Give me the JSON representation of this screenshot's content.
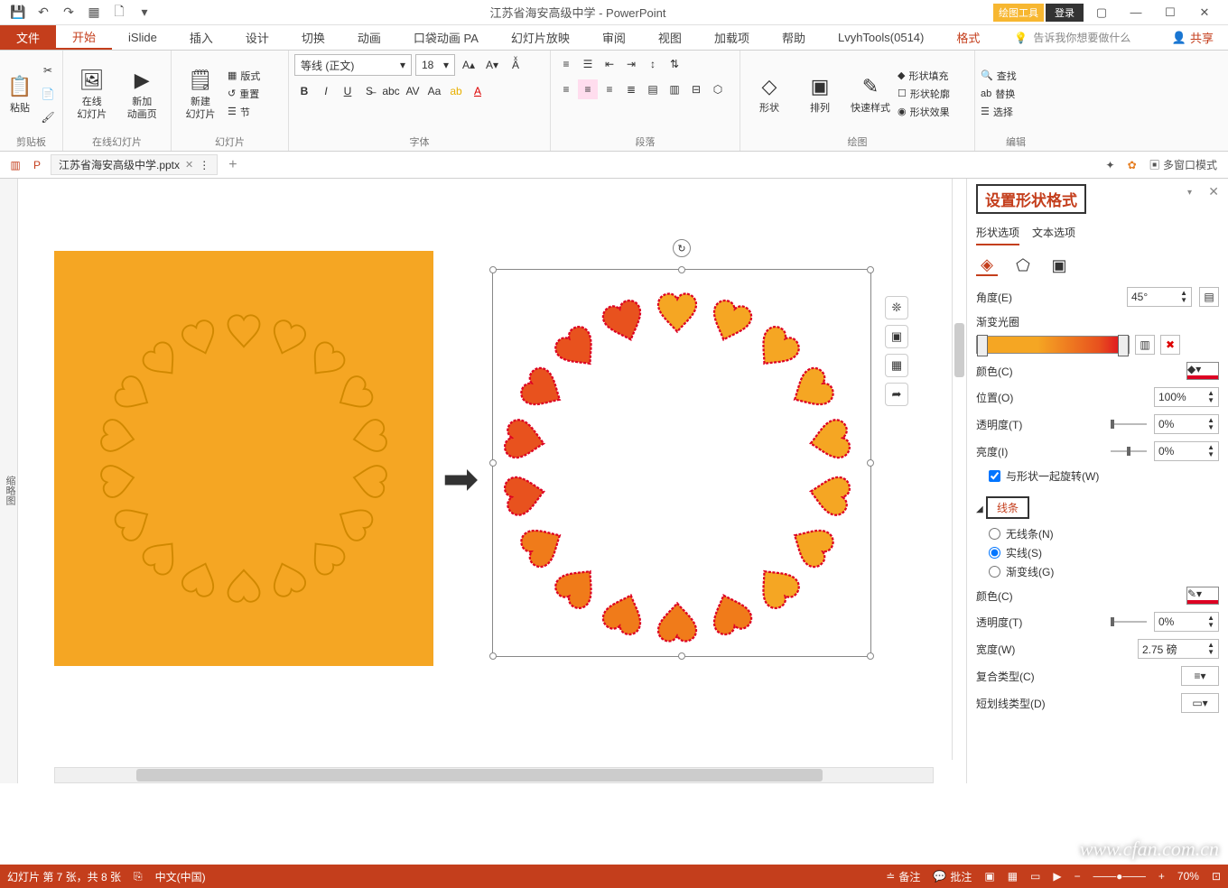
{
  "titlebar": {
    "doc_title": "江苏省海安高级中学 - PowerPoint",
    "contextual": "绘图工具",
    "login": "登录"
  },
  "ribbon_tabs": {
    "file": "文件",
    "home": "开始",
    "islide": "iSlide",
    "insert": "插入",
    "design": "设计",
    "transition": "切换",
    "animation": "动画",
    "pa": "口袋动画 PA",
    "slideshow": "幻灯片放映",
    "review": "审阅",
    "view": "视图",
    "addin": "加载项",
    "help": "帮助",
    "lvyh": "LvyhTools(0514)",
    "format": "格式",
    "tellme": "告诉我你想要做什么",
    "share": "共享"
  },
  "ribbon": {
    "clipboard": {
      "paste": "粘贴",
      "label": "剪贴板"
    },
    "online": {
      "online_anim": "在线\n幻灯片",
      "add_anim": "新加\n动画页",
      "label": "在线幻灯片"
    },
    "slides": {
      "new_slide": "新建\n幻灯片",
      "layout": "版式",
      "reset": "重置",
      "section": "节",
      "label": "幻灯片"
    },
    "font": {
      "name": "等线 (正文)",
      "size": "18",
      "label": "字体"
    },
    "paragraph": {
      "label": "段落"
    },
    "drawing": {
      "shapes": "形状",
      "arrange": "排列",
      "quickstyle": "快速样式",
      "fill": "形状填充",
      "outline": "形状轮廓",
      "effects": "形状效果",
      "label": "绘图"
    },
    "editing": {
      "find": "查找",
      "replace": "替换",
      "select": "选择",
      "label": "编辑"
    }
  },
  "doc_tabs": {
    "tab1": "江苏省海安高级中学.pptx",
    "multi_window": "多窗口模式"
  },
  "collapse_label": "缩略图",
  "format_pane": {
    "title": "设置形状格式",
    "shape_opts": "形状选项",
    "text_opts": "文本选项",
    "angle_label": "角度(E)",
    "angle_val": "45°",
    "gradient_stops": "渐变光圈",
    "color_label": "颜色(C)",
    "position_label": "位置(O)",
    "position_val": "100%",
    "transparency_label": "透明度(T)",
    "transparency_val": "0%",
    "brightness_label": "亮度(I)",
    "brightness_val": "0%",
    "rotate_with": "与形状一起旋转(W)",
    "line_section": "线条",
    "no_line": "无线条(N)",
    "solid_line": "实线(S)",
    "gradient_line": "渐变线(G)",
    "line_color_label": "颜色(C)",
    "line_trans_label": "透明度(T)",
    "line_trans_val": "0%",
    "width_label": "宽度(W)",
    "width_val": "2.75 磅",
    "compound_label": "复合类型(C)",
    "dash_label": "短划线类型(D)"
  },
  "statusbar": {
    "slide_info": "幻灯片 第 7 张，共 8 张",
    "lang": "中文(中国)",
    "notes": "备注",
    "comments": "批注",
    "zoom": "70%"
  },
  "watermark": "www.cfan.com.cn"
}
